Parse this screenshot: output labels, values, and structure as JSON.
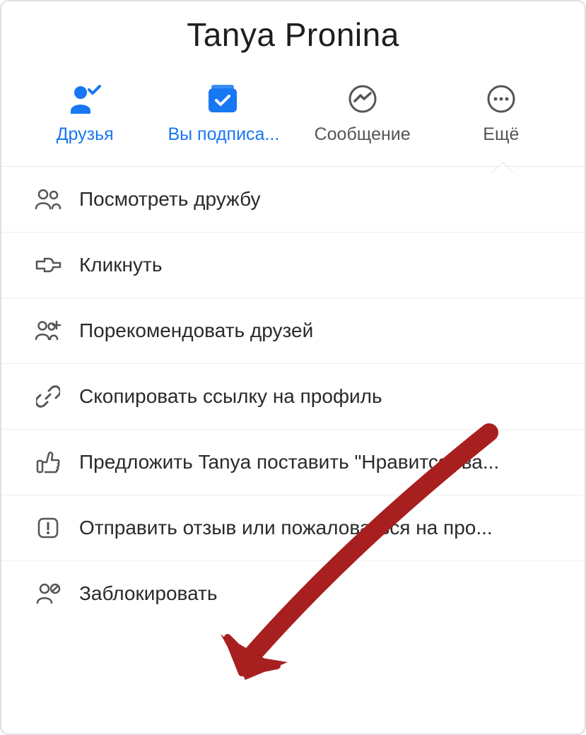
{
  "profile": {
    "name": "Tanya Pronina"
  },
  "actions": [
    {
      "id": "friends",
      "label": "Друзья",
      "icon": "friend-check-icon",
      "active": true
    },
    {
      "id": "following",
      "label": "Вы подписа...",
      "icon": "following-icon",
      "active": true
    },
    {
      "id": "message",
      "label": "Сообщение",
      "icon": "messenger-icon",
      "active": false
    },
    {
      "id": "more",
      "label": "Ещё",
      "icon": "more-icon",
      "active": false
    }
  ],
  "menu": [
    {
      "id": "see-friendship",
      "label": "Посмотреть дружбу",
      "icon": "people-icon"
    },
    {
      "id": "poke",
      "label": "Кликнуть",
      "icon": "point-icon"
    },
    {
      "id": "suggest-friends",
      "label": "Порекомендовать друзей",
      "icon": "people-plus-icon"
    },
    {
      "id": "copy-link",
      "label": "Скопировать ссылку на профиль",
      "icon": "link-icon"
    },
    {
      "id": "invite-like",
      "label": "Предложить Tanya поставить \"Нравится\" ва...",
      "icon": "thumbs-up-icon"
    },
    {
      "id": "report",
      "label": "Отправить отзыв или пожаловаться на про...",
      "icon": "report-icon"
    },
    {
      "id": "block",
      "label": "Заблокировать",
      "icon": "block-user-icon"
    }
  ],
  "colors": {
    "accent": "#1877f2",
    "iconGray": "#555",
    "arrow": "#a81f1f"
  }
}
